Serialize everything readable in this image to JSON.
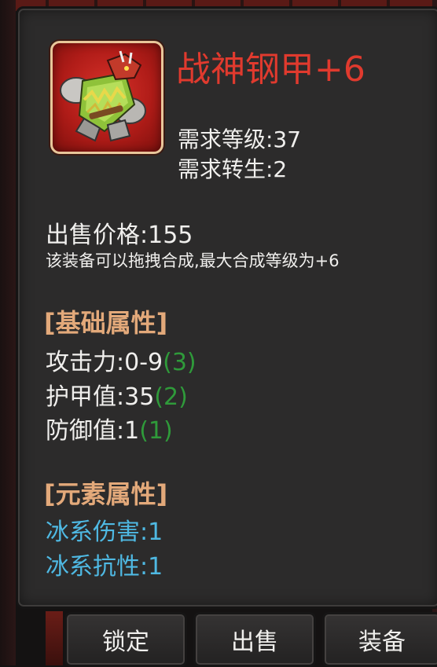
{
  "item": {
    "name": "战神钢甲+6",
    "icon": "armor-icon",
    "required_level_label": "需求等级:37",
    "required_rebirth_label": "需求转生:2",
    "sell_price_label": "出售价格:155",
    "merge_note": "该装备可以拖拽合成,最大合成等级为+6"
  },
  "base_attributes": {
    "header": "[基础属性]",
    "items": [
      {
        "label": "攻击力:0-9",
        "bonus": "(3)"
      },
      {
        "label": "护甲值:35",
        "bonus": "(2)"
      },
      {
        "label": "防御值:1",
        "bonus": "(1)"
      }
    ]
  },
  "element_attributes": {
    "header": "[元素属性]",
    "items": [
      {
        "label": "冰系伤害:1"
      },
      {
        "label": "冰系抗性:1"
      }
    ]
  },
  "buttons": {
    "lock": "锁定",
    "sell": "出售",
    "equip": "装备"
  },
  "colors": {
    "item_name": "#e03a2e",
    "section_header": "#e3a97a",
    "bonus": "#2f9a3a",
    "element": "#4fb9e3",
    "panel_bg": "#2c2b2b"
  }
}
